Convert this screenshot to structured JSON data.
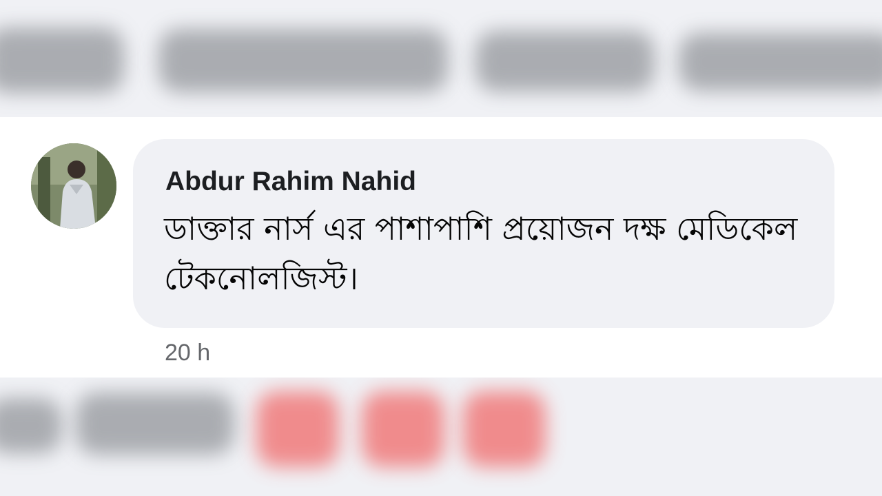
{
  "comment": {
    "author": "Abdur Rahim Nahid",
    "text": "ডাক্তার নার্স এর পাশাপাশি প্রয়োজন দক্ষ মেডিকেল টেকনোলজিস্ট।",
    "timestamp": "20 h",
    "avatar_icon": "profile-photo"
  },
  "colors": {
    "bubble_background": "#f0f1f5",
    "author_text": "#1c1e21",
    "comment_text": "#050505",
    "timestamp_text": "#65676b",
    "blurred_reaction": "#f06a6a"
  }
}
